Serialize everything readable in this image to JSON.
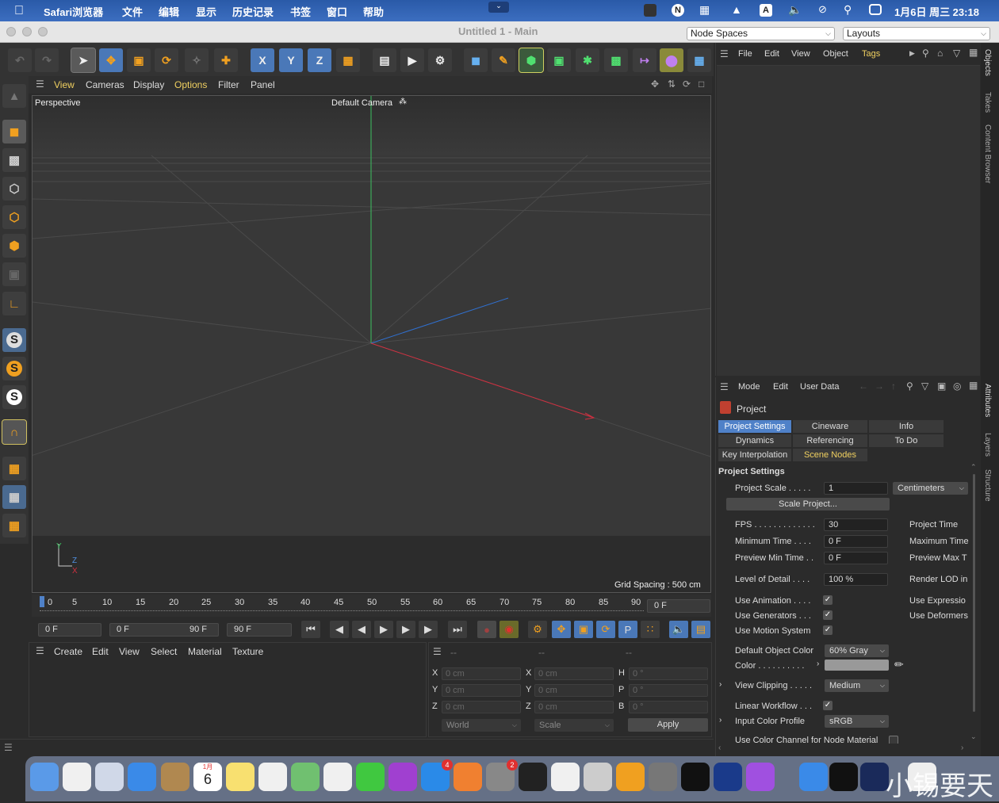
{
  "menubar": {
    "app": "Safari浏览器",
    "items": [
      "文件",
      "编辑",
      "显示",
      "历史记录",
      "书签",
      "窗口",
      "帮助"
    ],
    "clock": "1月6日 周三 23:18"
  },
  "window": {
    "title": "Untitled 1 - Main",
    "node_spaces": "Node Spaces",
    "layouts": "Layouts"
  },
  "toolbar": {
    "x_label": "X",
    "y_label": "Y",
    "z_label": "Z"
  },
  "viewport_menu": [
    "View",
    "Cameras",
    "Display",
    "Options",
    "Filter",
    "Panel"
  ],
  "viewport": {
    "name": "Perspective",
    "camera": "Default Camera",
    "grid_spacing": "Grid Spacing : 500 cm",
    "axis_y": "Y",
    "axis_z": "Z",
    "axis_x": "X"
  },
  "timeline": {
    "ticks": [
      "0",
      "5",
      "10",
      "15",
      "20",
      "25",
      "30",
      "35",
      "40",
      "45",
      "50",
      "55",
      "60",
      "65",
      "70",
      "75",
      "80",
      "85",
      "90"
    ],
    "current": "0 F",
    "start": "0 F",
    "range_start": "0 F",
    "range_end": "90 F",
    "end": "90 F"
  },
  "material_menu": [
    "Create",
    "Edit",
    "View",
    "Select",
    "Material",
    "Texture"
  ],
  "coords": {
    "header": [
      "--",
      "--",
      "--"
    ],
    "rows": [
      {
        "a": "X",
        "av": "0 cm",
        "b": "X",
        "bv": "0 cm",
        "c": "H",
        "cv": "0 °"
      },
      {
        "a": "Y",
        "av": "0 cm",
        "b": "Y",
        "bv": "0 cm",
        "c": "P",
        "cv": "0 °"
      },
      {
        "a": "Z",
        "av": "0 cm",
        "b": "Z",
        "bv": "0 cm",
        "c": "B",
        "cv": "0 °"
      }
    ],
    "world": "World",
    "scale": "Scale",
    "apply": "Apply"
  },
  "objects_menu": [
    "File",
    "Edit",
    "View",
    "Object",
    "Tags"
  ],
  "attributes_menu": [
    "Mode",
    "Edit",
    "User Data"
  ],
  "attributes": {
    "object": "Project",
    "tabs_row1": [
      "Project Settings",
      "Cineware",
      "Info"
    ],
    "tabs_row2": [
      "Dynamics",
      "Referencing",
      "To Do"
    ],
    "tabs_row3": [
      "Key Interpolation",
      "Scene Nodes"
    ],
    "section": "Project Settings",
    "project_scale_label": "Project Scale . . . . .",
    "project_scale_value": "1",
    "project_scale_unit": "Centimeters",
    "scale_project": "Scale Project...",
    "fps_label": "FPS . . . . . . . . . . . . .",
    "fps_value": "30",
    "min_time_label": "Minimum Time . . . .",
    "min_time_value": "0 F",
    "preview_min_label": "Preview Min Time . .",
    "preview_min_value": "0 F",
    "lod_label": "Level of Detail . . . .",
    "lod_value": "100 %",
    "project_time": "Project Time",
    "max_time": "Maximum Time",
    "preview_max": "Preview Max T",
    "render_lod": "Render LOD in",
    "use_animation": "Use Animation . . . .",
    "use_generators": "Use Generators . . .",
    "use_motion": "Use Motion System",
    "use_expression": "Use Expressio",
    "use_deformers": "Use Deformers",
    "default_color_label": "Default Object Color",
    "default_color_value": "60% Gray",
    "color_label": "Color . . . . . . . . . .",
    "view_clipping_label": "View Clipping . . . . .",
    "view_clipping_value": "Medium",
    "linear_workflow": "Linear Workflow . . .",
    "input_profile_label": "Input Color Profile",
    "input_profile_value": "sRGB",
    "use_color_channel": "Use Color Channel for Node Material"
  },
  "side_tabs": [
    "Objects",
    "Takes",
    "Content Browser",
    "Attributes",
    "Layers",
    "Structure"
  ],
  "dock_badges": {
    "calendar_month": "1月",
    "calendar_day": "6",
    "appstore": "4",
    "prefs": "2"
  },
  "watermark": "小锡要天"
}
